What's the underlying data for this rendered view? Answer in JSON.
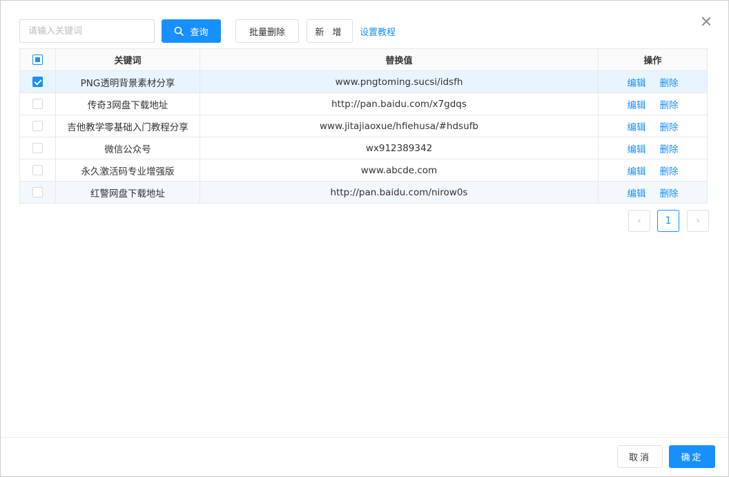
{
  "toolbar": {
    "search_placeholder": "请输入关键词",
    "search_value": "",
    "query_label": "查询",
    "batch_delete_label": "批量删除",
    "add_label": "新 增",
    "tutorial_link": "设置教程"
  },
  "table": {
    "headers": [
      "关键词",
      "替换值",
      "操作"
    ],
    "rows": [
      {
        "keyword": "PNG透明背景素材分享",
        "value": "www.pngtoming.sucsi/idsfh",
        "checked": true
      },
      {
        "keyword": "传奇3网盘下载地址",
        "value": "http://pan.baidu.com/x7gdqs",
        "checked": false
      },
      {
        "keyword": "吉他教学零基础入门教程分享",
        "value": "www.jitajiaoxue/hfiehusa/#hdsufb",
        "checked": false
      },
      {
        "keyword": "微信公众号",
        "value": "wx912389342",
        "checked": false
      },
      {
        "keyword": "永久激活码专业增强版",
        "value": "www.abcde.com",
        "checked": false
      },
      {
        "keyword": "红警网盘下载地址",
        "value": "http://pan.baidu.com/nirow0s",
        "checked": false
      }
    ],
    "edit_label": "编辑",
    "delete_label": "删除"
  },
  "pagination": {
    "prev_icon": "chevron-left-icon",
    "current_page": "1",
    "next_icon": "chevron-right-icon"
  },
  "footer": {
    "cancel_label": "取消",
    "ok_label": "确定"
  },
  "colors": {
    "primary": "#1890ff",
    "selected_row": "#e8f4ff"
  }
}
